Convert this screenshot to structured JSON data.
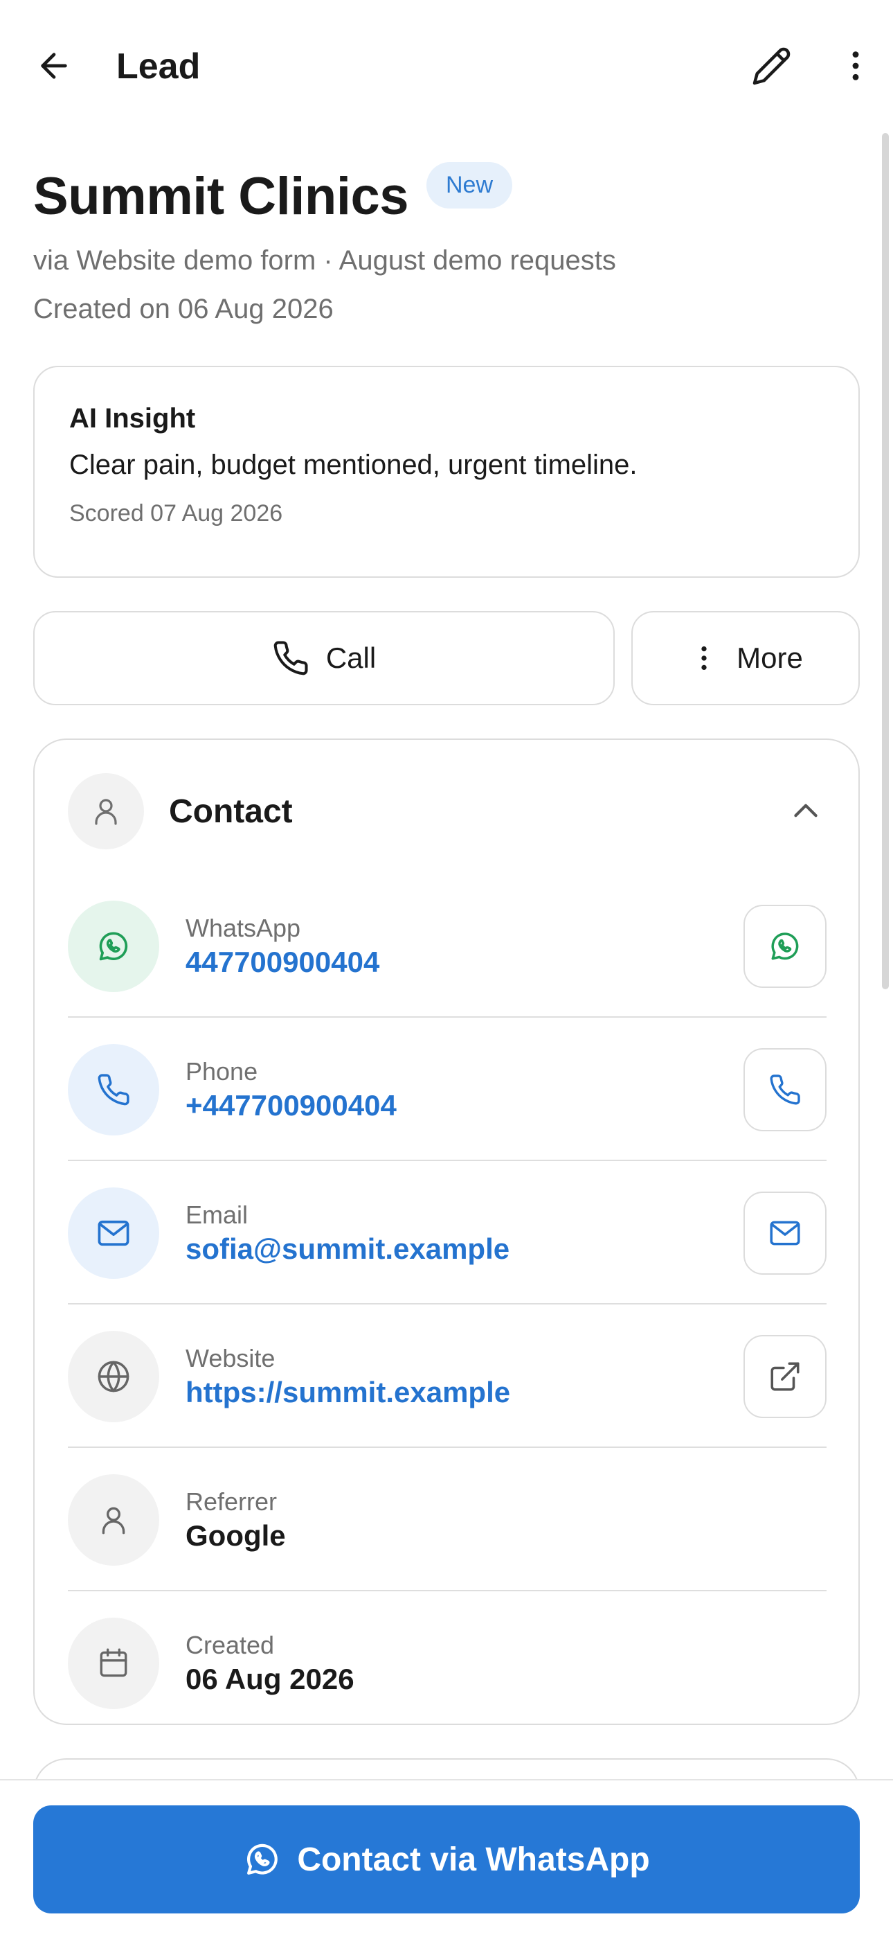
{
  "header": {
    "title": "Lead"
  },
  "lead": {
    "name": "Summit Clinics",
    "status": "New",
    "source": "via Website demo form · August demo requests",
    "created": "Created on 06 Aug 2026"
  },
  "insight": {
    "title": "AI Insight",
    "text": "Clear pain, budget mentioned, urgent timeline.",
    "scored": "Scored 07 Aug 2026"
  },
  "actions": {
    "call_label": "Call",
    "more_label": "More"
  },
  "contact": {
    "title": "Contact",
    "rows": [
      {
        "label": "WhatsApp",
        "value": "447700900404",
        "icon": "whatsapp-icon"
      },
      {
        "label": "Phone",
        "value": "+447700900404",
        "icon": "phone-icon"
      },
      {
        "label": "Email",
        "value": "sofia@summit.example",
        "icon": "mail-icon"
      },
      {
        "label": "Website",
        "value": "https://summit.example",
        "icon": "globe-icon"
      },
      {
        "label": "Referrer",
        "value": "Google",
        "icon": "person-icon"
      },
      {
        "label": "Created",
        "value": "06 Aug 2026",
        "icon": "calendar-icon"
      }
    ]
  },
  "cta": {
    "label": "Contact via WhatsApp"
  },
  "colors": {
    "accent": "#2678d6",
    "link": "#2473cf",
    "whatsapp_green": "#1f9e57",
    "badge_bg": "#e6f0fb"
  }
}
